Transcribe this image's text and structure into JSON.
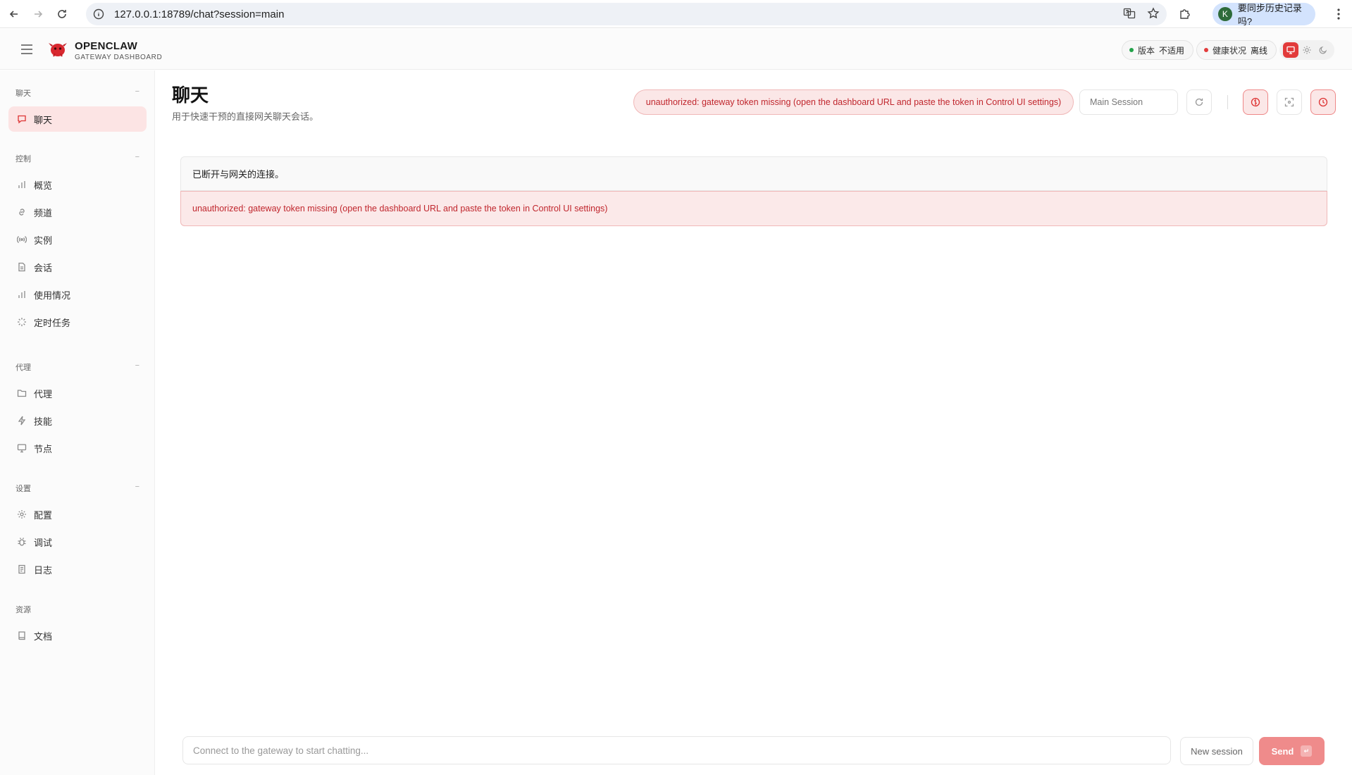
{
  "browser": {
    "url": "127.0.0.1:18789/chat?session=main",
    "profile_initial": "K",
    "profile_prompt": "要同步历史记录吗?"
  },
  "topbar": {
    "brand_title": "OPENCLAW",
    "brand_subtitle": "GATEWAY DASHBOARD",
    "version_label": "版本",
    "version_value": "不适用",
    "health_label": "健康状况",
    "health_value": "离线",
    "colors": {
      "ok": "#22a34a",
      "error": "#e23b3b"
    }
  },
  "sidebar": {
    "sections": [
      {
        "label": "聊天",
        "collapse": "−"
      },
      {
        "label": "控制",
        "collapse": "−"
      },
      {
        "label": "代理",
        "collapse": "−"
      },
      {
        "label": "设置",
        "collapse": "−"
      },
      {
        "label": "资源"
      }
    ],
    "items": [
      {
        "label": "聊天",
        "icon": "chat-bubble-icon",
        "active": true
      },
      {
        "label": "概览",
        "icon": "bar-chart-icon"
      },
      {
        "label": "频道",
        "icon": "link-icon"
      },
      {
        "label": "实例",
        "icon": "radio-signal-icon"
      },
      {
        "label": "会话",
        "icon": "document-icon"
      },
      {
        "label": "使用情况",
        "icon": "bar-chart-icon"
      },
      {
        "label": "定时任务",
        "icon": "loader-icon"
      },
      {
        "label": "代理",
        "icon": "folder-icon"
      },
      {
        "label": "技能",
        "icon": "lightning-icon"
      },
      {
        "label": "节点",
        "icon": "monitor-icon"
      },
      {
        "label": "配置",
        "icon": "gear-icon"
      },
      {
        "label": "调试",
        "icon": "bug-icon"
      },
      {
        "label": "日志",
        "icon": "log-icon"
      },
      {
        "label": "文档",
        "icon": "book-icon"
      }
    ]
  },
  "main": {
    "title": "聊天",
    "subtitle": "用于快速干预的直接网关聊天会话。",
    "error_pill": "unauthorized: gateway token missing (open the dashboard URL and paste the token in Control UI settings)",
    "session_select": "Main Session",
    "status_message": "已断开与网关的连接。",
    "error_message": "unauthorized: gateway token missing (open the dashboard URL and paste the token in Control UI settings)"
  },
  "composer": {
    "placeholder": "Connect to the gateway to start chatting...",
    "new_session_label": "New session",
    "send_label": "Send",
    "send_shortcut": "↵"
  }
}
